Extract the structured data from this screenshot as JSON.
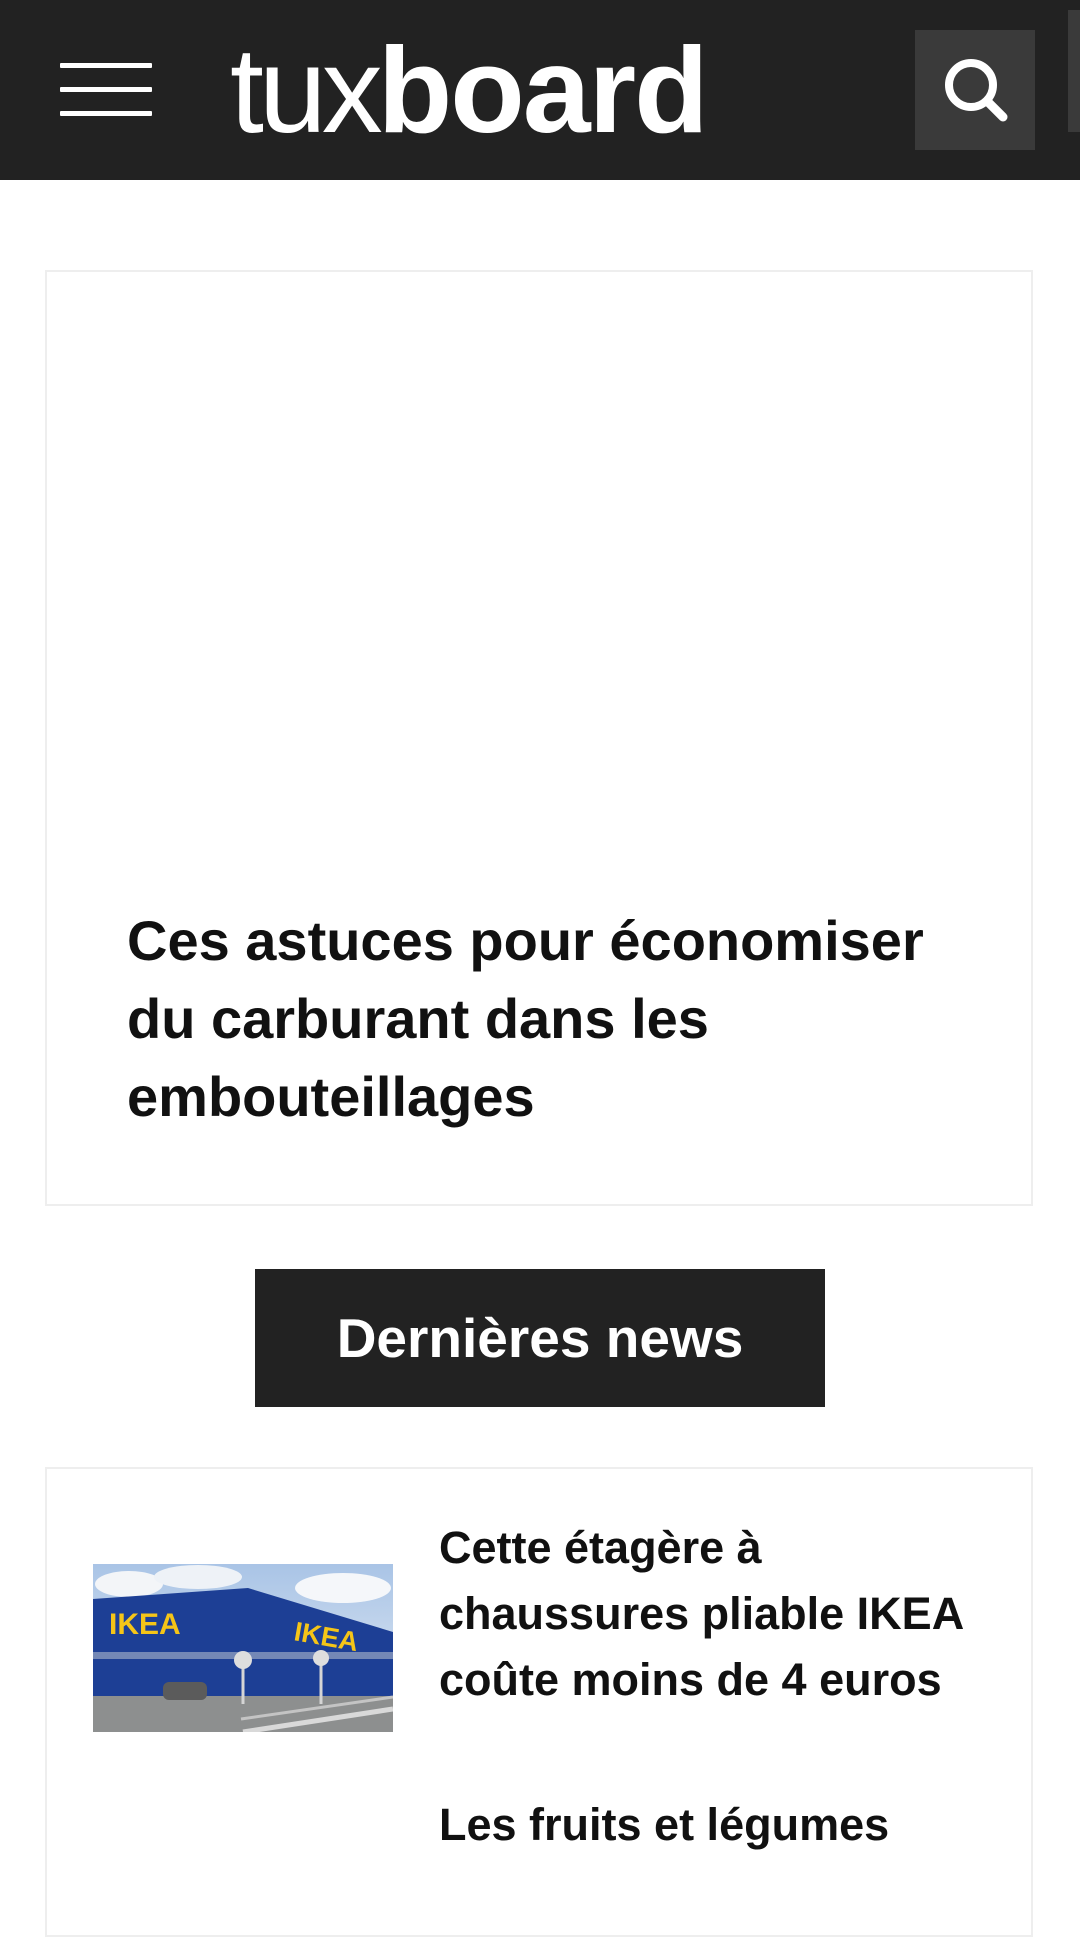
{
  "header": {
    "logo_light": "tux",
    "logo_bold": "board",
    "menu_icon": "hamburger-menu-icon",
    "search_icon": "search-icon",
    "background_color": "#222222"
  },
  "featured": {
    "title": "Ces astuces pour économiser du carburant dans les embouteillages"
  },
  "latest_news": {
    "heading": "Dernières news",
    "items": [
      {
        "title": "Cette étagère à chaussures pliable IKEA coûte moins de 4 euros",
        "thumbnail_sign": "IKEA"
      },
      {
        "title": "Les fruits et légumes"
      }
    ]
  },
  "colors": {
    "header_bg": "#222222",
    "button_bg": "#3a3a3a",
    "heading_bg": "#222222",
    "ikea_blue": "#1d3f95",
    "ikea_yellow": "#f5c518"
  }
}
